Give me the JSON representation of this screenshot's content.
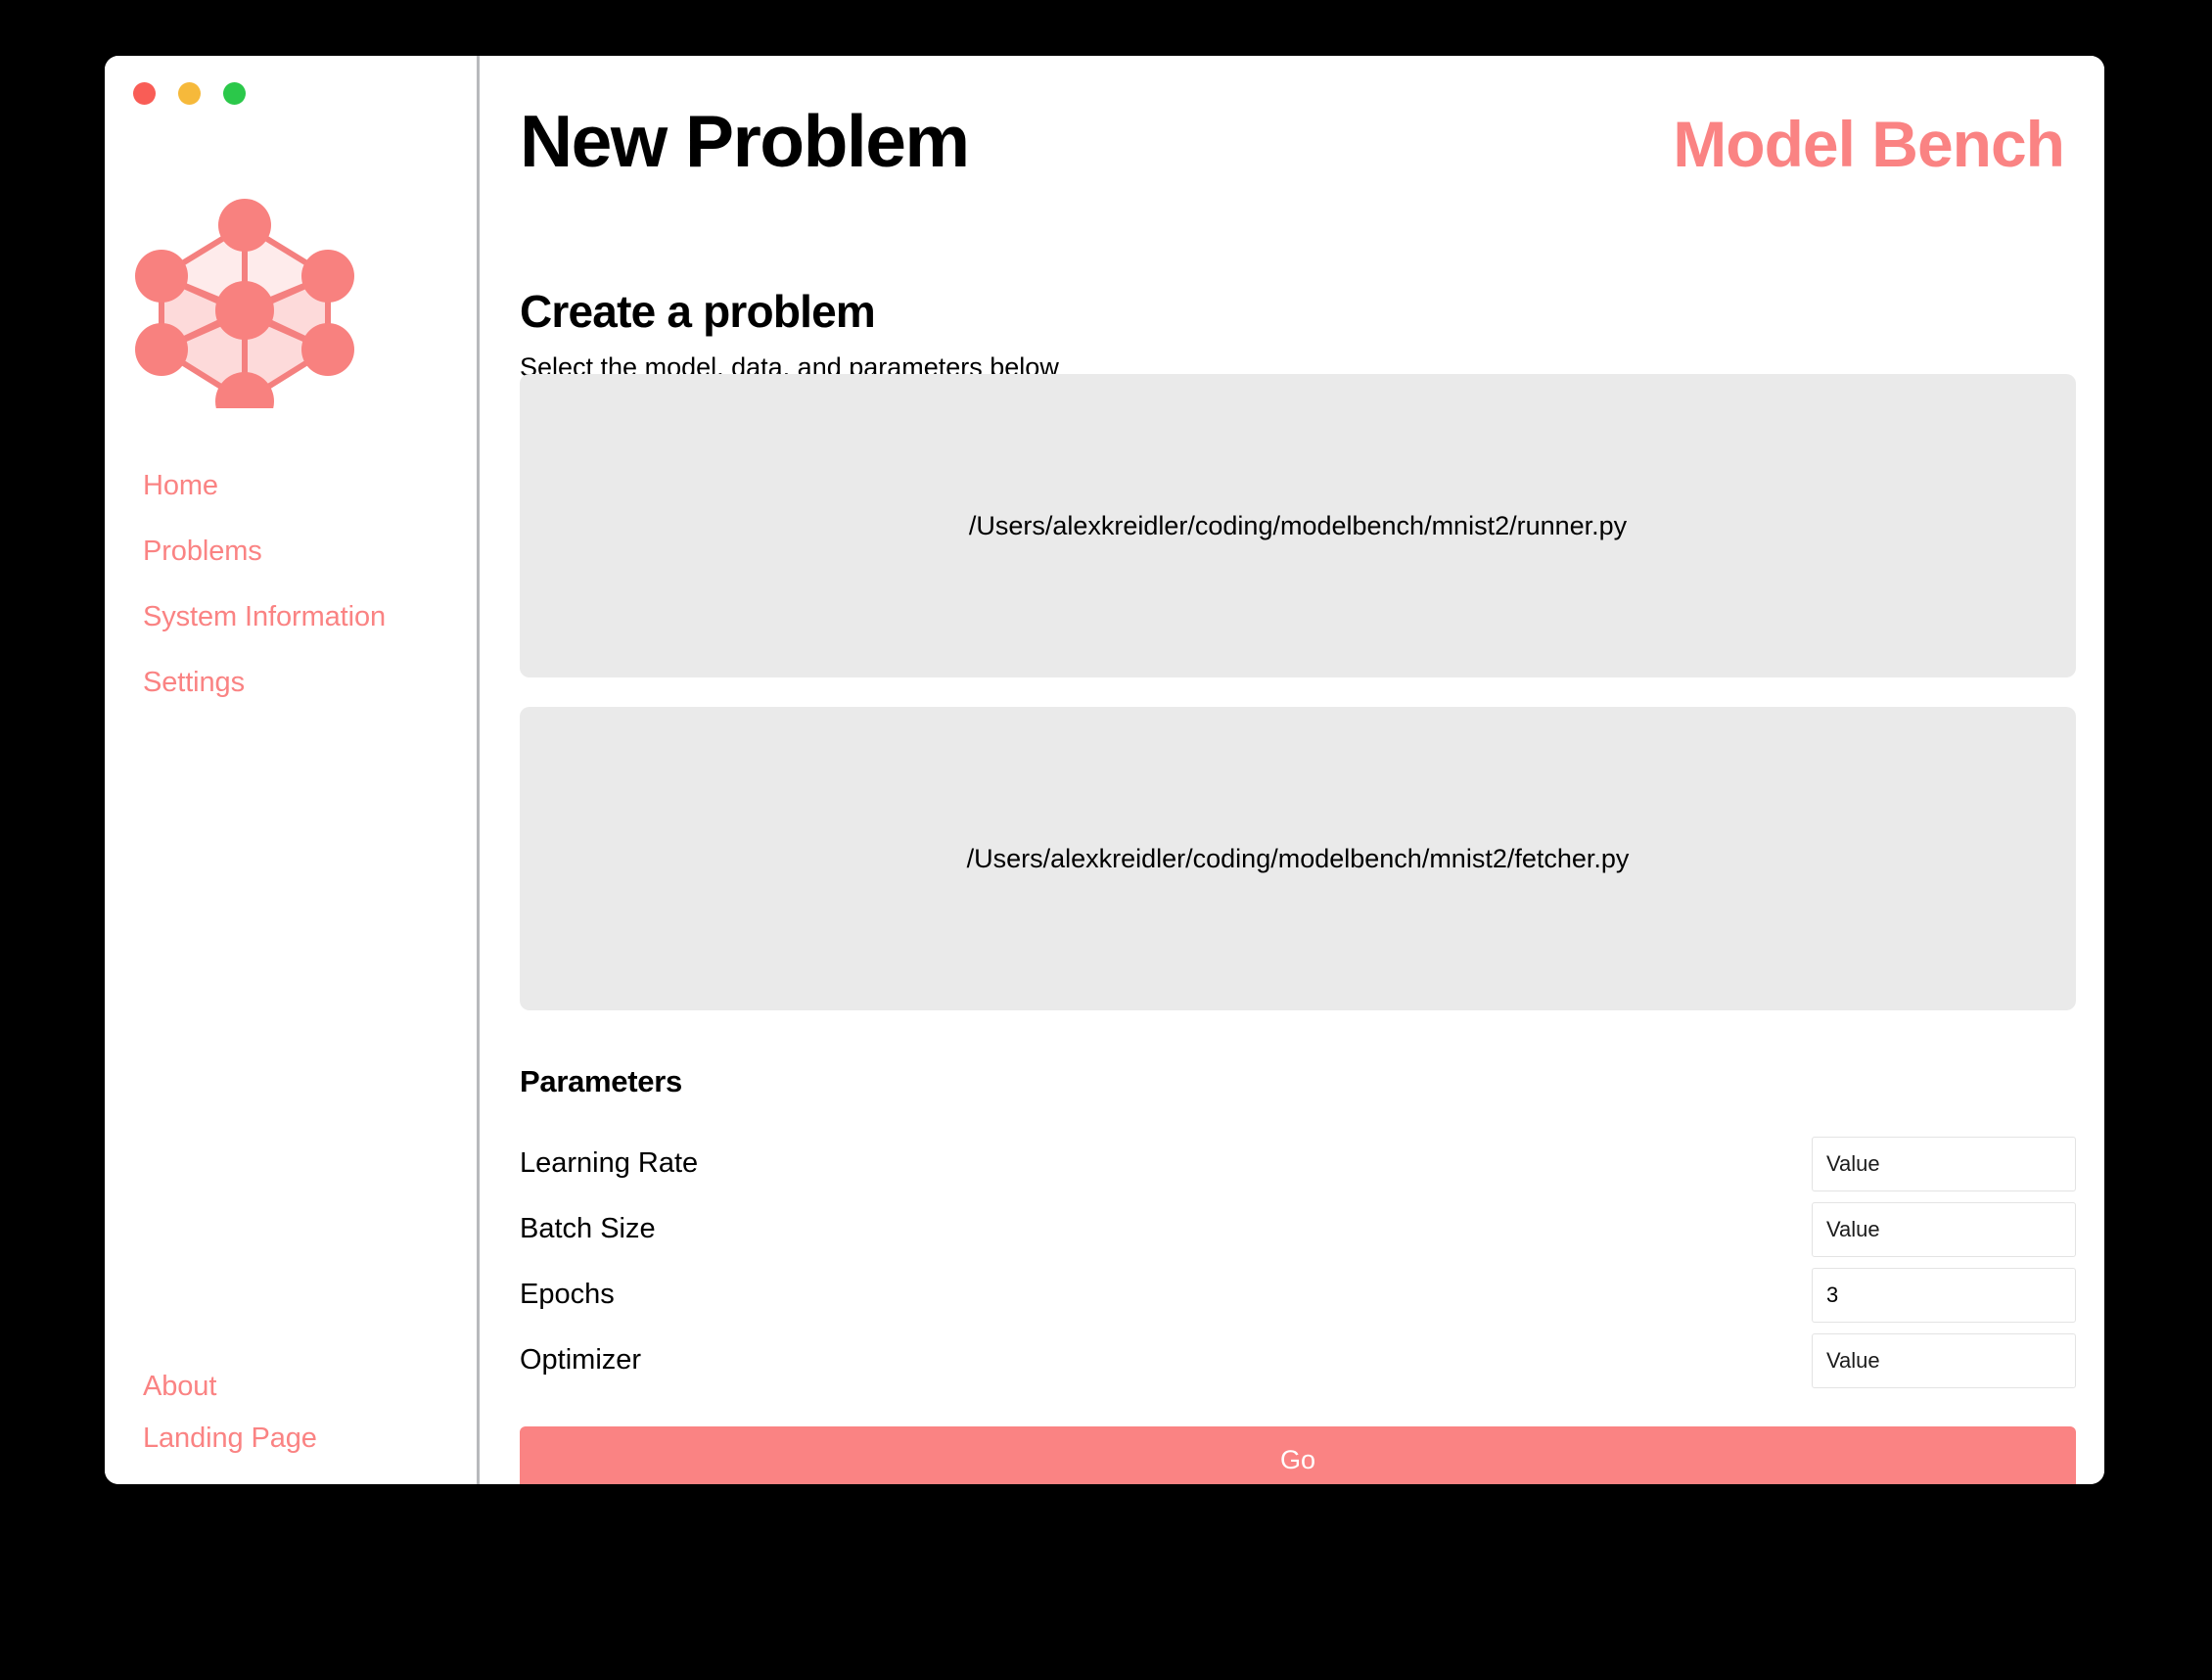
{
  "window": {
    "traffic_lights": [
      {
        "name": "close",
        "color": "#f95d56"
      },
      {
        "name": "minimize",
        "color": "#f6b93b"
      },
      {
        "name": "zoom",
        "color": "#2bc84a"
      }
    ]
  },
  "theme": {
    "accent": "#fa8383",
    "dropzone_bg": "#eaeaea",
    "text": "#000000",
    "divider": "#b8b9bc"
  },
  "sidebar": {
    "logo_name": "neural-network-logo",
    "primary_items": [
      {
        "label": "Home"
      },
      {
        "label": "Problems"
      },
      {
        "label": "System Information"
      },
      {
        "label": "Settings"
      }
    ],
    "secondary_items": [
      {
        "label": "About"
      },
      {
        "label": "Landing Page"
      }
    ]
  },
  "header": {
    "title": "New Problem",
    "brand": "Model Bench"
  },
  "main": {
    "section_heading": "Create a problem",
    "section_subheading": "Select the model, data, and parameters below",
    "runner_path": "/Users/alexkreidler/coding/modelbench/mnist2/runner.py",
    "fetcher_path": "/Users/alexkreidler/coding/modelbench/mnist2/fetcher.py",
    "parameters_heading": "Parameters",
    "parameters": [
      {
        "label": "Learning Rate",
        "value": "",
        "placeholder": "Value"
      },
      {
        "label": "Batch Size",
        "value": "",
        "placeholder": "Value"
      },
      {
        "label": "Epochs",
        "value": "3",
        "placeholder": "Value"
      },
      {
        "label": "Optimizer",
        "value": "",
        "placeholder": "Value"
      }
    ],
    "go_label": "Go"
  }
}
